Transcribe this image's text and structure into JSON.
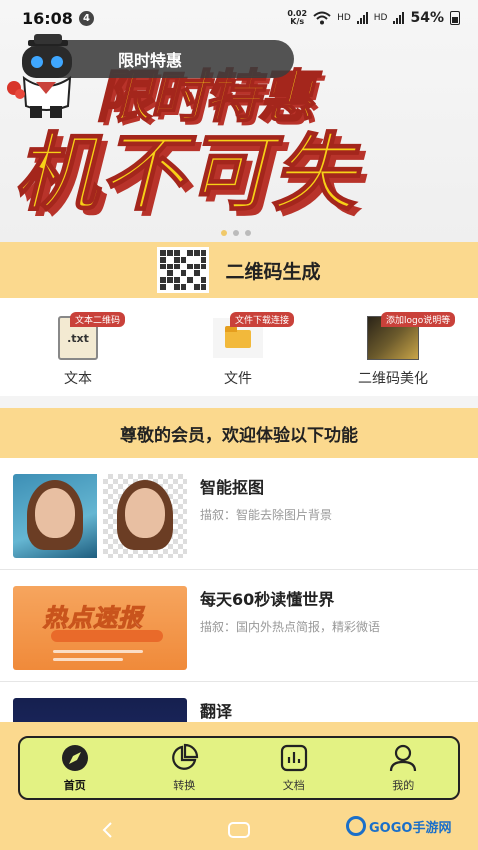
{
  "status_bar": {
    "time": "16:08",
    "notification_count": "4",
    "net_speed_value": "0.02",
    "net_speed_unit": "K/s",
    "hd_1": "HD",
    "hd_2": "HD",
    "battery_percent": "54%"
  },
  "banner": {
    "chip_label": "限时特惠",
    "headline_line1": "限时特惠",
    "headline_line2": "机不可失",
    "page_count": 3,
    "active_page": 0
  },
  "qr_section": {
    "title": "二维码生成",
    "options": [
      {
        "tag": "文本二维码",
        "label": "文本",
        "file_ext": ".txt"
      },
      {
        "tag": "文件下载连接",
        "label": "文件"
      },
      {
        "tag": "添加logo说明等",
        "label": "二维码美化"
      }
    ]
  },
  "member_section": {
    "title": "尊敬的会员，欢迎体验以下功能"
  },
  "features": [
    {
      "title": "智能抠图",
      "desc": "描叙：智能去除图片背景"
    },
    {
      "title": "每天60秒读懂世界",
      "desc": "描叙：国内外热点简报，精彩微语",
      "image_text": "热点速报"
    },
    {
      "title": "翻译",
      "desc": ""
    }
  ],
  "tabs": [
    {
      "label": "首页",
      "icon": "compass-icon",
      "active": true
    },
    {
      "label": "转换",
      "icon": "pie-chart-icon",
      "active": false
    },
    {
      "label": "文档",
      "icon": "bar-chart-icon",
      "active": false
    },
    {
      "label": "我的",
      "icon": "user-icon",
      "active": false
    }
  ],
  "watermark": "GOGO手游网",
  "colors": {
    "section_yellow": "#fbd98e",
    "tab_bar_green": "#e3f283",
    "tag_red": "#c9413a",
    "headline_yellow": "#f7d117"
  }
}
